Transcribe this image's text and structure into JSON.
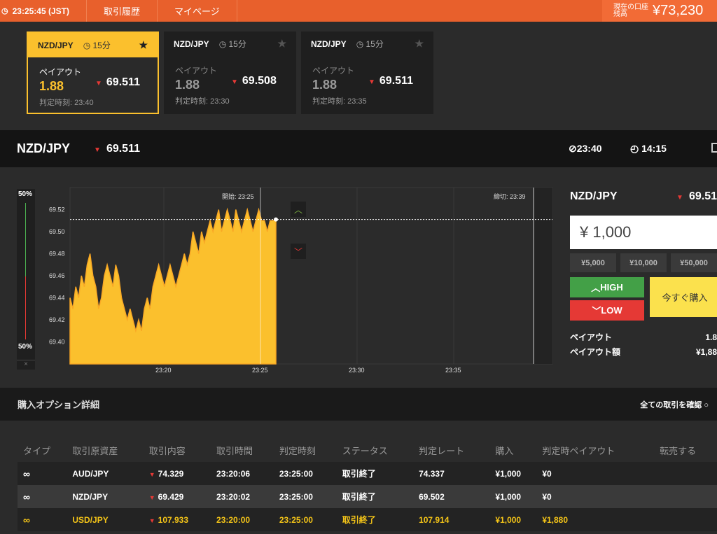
{
  "topbar": {
    "clock_icon": "clock-icon",
    "time": "23:25:45 (JST)",
    "nav": [
      "取引履歴",
      "マイページ"
    ],
    "balance_label": "現在の口座残高",
    "balance_value": "¥73,230"
  },
  "cards": [
    {
      "pair": "NZD/JPY",
      "duration": "15分",
      "payout_label": "ペイアウト",
      "payout": "1.88",
      "rate": "69.511",
      "judge": "判定時刻: 23:40",
      "active": true
    },
    {
      "pair": "NZD/JPY",
      "duration": "15分",
      "payout_label": "ペイアウト",
      "payout": "1.88",
      "rate": "69.508",
      "judge": "判定時刻: 23:30",
      "active": false
    },
    {
      "pair": "NZD/JPY",
      "duration": "15分",
      "payout_label": "ペイアウト",
      "payout": "1.88",
      "rate": "69.511",
      "judge": "判定時刻: 23:35",
      "active": false
    }
  ],
  "pairbar": {
    "symbol": "NZD/JPY",
    "rate": "69.511",
    "close_time": "23:40",
    "remaining": "14:15"
  },
  "sentiment": {
    "high_pct": "50%",
    "low_pct": "50%",
    "close": "×"
  },
  "chart_data": {
    "type": "area",
    "y_ticks": [
      "69.52",
      "69.50",
      "69.48",
      "69.46",
      "69.44",
      "69.42",
      "69.40"
    ],
    "x_ticks": [
      "23:20",
      "23:25",
      "23:30",
      "23:35"
    ],
    "ylim": [
      69.38,
      69.54
    ],
    "start_label": "開始: 23:25",
    "end_label": "締切: 23:39",
    "current_rate": 69.511,
    "x": [
      0,
      1,
      2,
      3,
      4,
      5,
      6,
      7,
      8,
      9,
      10,
      11,
      12,
      13,
      14,
      15,
      16,
      17,
      18,
      19,
      20,
      21,
      22,
      23,
      24,
      25,
      26,
      27,
      28,
      29,
      30,
      31,
      32,
      33,
      34,
      35,
      36,
      37,
      38,
      39,
      40,
      41,
      42,
      43,
      44,
      45,
      46,
      47,
      48,
      49,
      50,
      51,
      52,
      53,
      54,
      55,
      56,
      57,
      58,
      59,
      60,
      61,
      62,
      63,
      64,
      65,
      66,
      67,
      68,
      69,
      70,
      71,
      72
    ],
    "values": [
      69.44,
      69.43,
      69.45,
      69.44,
      69.46,
      69.45,
      69.47,
      69.48,
      69.46,
      69.45,
      69.43,
      69.44,
      69.46,
      69.47,
      69.46,
      69.45,
      69.47,
      69.46,
      69.44,
      69.43,
      69.42,
      69.43,
      69.42,
      69.41,
      69.42,
      69.41,
      69.43,
      69.44,
      69.43,
      69.45,
      69.46,
      69.47,
      69.46,
      69.45,
      69.46,
      69.47,
      69.46,
      69.45,
      69.46,
      69.47,
      69.48,
      69.47,
      69.48,
      69.5,
      69.49,
      69.48,
      69.5,
      69.49,
      69.5,
      69.51,
      69.5,
      69.51,
      69.52,
      69.5,
      69.51,
      69.52,
      69.51,
      69.5,
      69.52,
      69.51,
      69.5,
      69.51,
      69.52,
      69.51,
      69.5,
      69.51,
      69.52,
      69.51,
      69.51,
      69.5,
      69.51,
      69.51,
      69.511
    ]
  },
  "trade": {
    "symbol": "NZD/JPY",
    "rate": "69.51",
    "amount": "¥ 1,000",
    "quick": [
      "¥5,000",
      "¥10,000",
      "¥50,000"
    ],
    "high": "HIGH",
    "low": "LOW",
    "buy_now": "今すぐ購入",
    "payout_label": "ペイアウト",
    "payout_value": "1.8",
    "payout_amount_label": "ペイアウト額",
    "payout_amount_value": "¥1,88"
  },
  "details": {
    "title": "購入オプション詳細",
    "view_all": "全ての取引を確認"
  },
  "table": {
    "headers": [
      "タイプ",
      "取引原資産",
      "取引内容",
      "取引時間",
      "判定時刻",
      "ステータス",
      "判定レート",
      "購入",
      "判定時ペイアウト",
      "転売する"
    ],
    "rows": [
      {
        "type_icon": "link-icon",
        "asset": "AUD/JPY",
        "content": "74.329",
        "time": "23:20:06",
        "judge": "23:25:00",
        "status": "取引終了",
        "rate": "74.337",
        "buy": "¥1,000",
        "payout": "¥0",
        "resell": ""
      },
      {
        "type_icon": "link-icon",
        "asset": "NZD/JPY",
        "content": "69.429",
        "time": "23:20:02",
        "judge": "23:25:00",
        "status": "取引終了",
        "rate": "69.502",
        "buy": "¥1,000",
        "payout": "¥0",
        "resell": ""
      },
      {
        "type_icon": "link-icon",
        "asset": "USD/JPY",
        "content": "107.933",
        "time": "23:20:00",
        "judge": "23:25:00",
        "status": "取引終了",
        "rate": "107.914",
        "buy": "¥1,000",
        "payout": "¥1,880",
        "resell": ""
      }
    ]
  }
}
